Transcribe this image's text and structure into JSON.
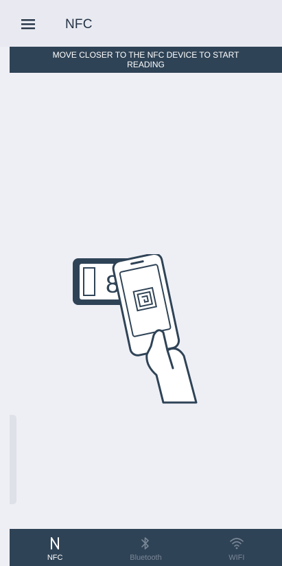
{
  "header": {
    "title": "NFC",
    "menu_icon": "hamburger-menu-icon"
  },
  "banner": {
    "message": "MOVE CLOSER TO THE NFC DEVICE TO START READING"
  },
  "illustration": {
    "icon": "nfc-tap-phone-illustration",
    "device_display": "8"
  },
  "bottom_nav": {
    "tabs": [
      {
        "label": "NFC",
        "icon": "nfc-icon",
        "active": true
      },
      {
        "label": "Bluetooth",
        "icon": "bluetooth-icon",
        "active": false
      },
      {
        "label": "WIFI",
        "icon": "wifi-icon",
        "active": false
      }
    ]
  },
  "colors": {
    "primary_dark": "#2f4356",
    "background": "#eeeff5",
    "active_label": "#ffffff",
    "inactive_label": "#7a8797"
  }
}
